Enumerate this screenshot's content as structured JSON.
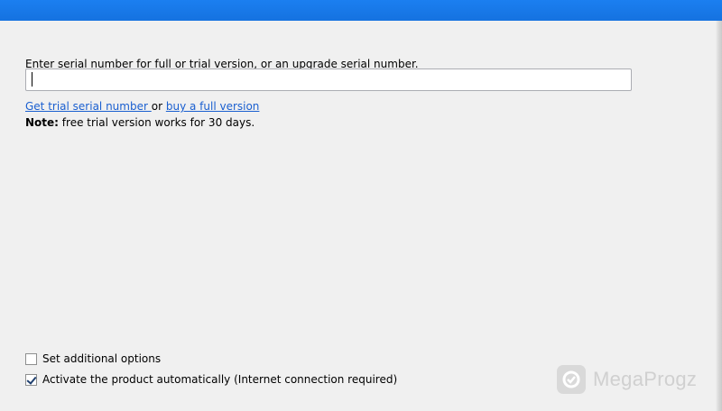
{
  "dialog": {
    "instruction": "Enter serial number for full or trial version, or an upgrade serial number.",
    "serial_input": {
      "value": "",
      "placeholder": ""
    },
    "links": {
      "trial_label": "Get trial serial number ",
      "separator": "or",
      "buy_label": "buy a full version"
    },
    "note": {
      "label": "Note:",
      "text": "free trial version works for 30 days."
    },
    "options": [
      {
        "label": "Set additional options",
        "checked": false
      },
      {
        "label": "Activate the product automatically (Internet connection required)",
        "checked": true
      }
    ]
  },
  "watermark": {
    "text": "MegaProgz",
    "icon": "megaprogz-logo-icon"
  },
  "colors": {
    "title_bar": "#1572e0",
    "link": "#1a5fd0",
    "background": "#f0f0f0"
  }
}
